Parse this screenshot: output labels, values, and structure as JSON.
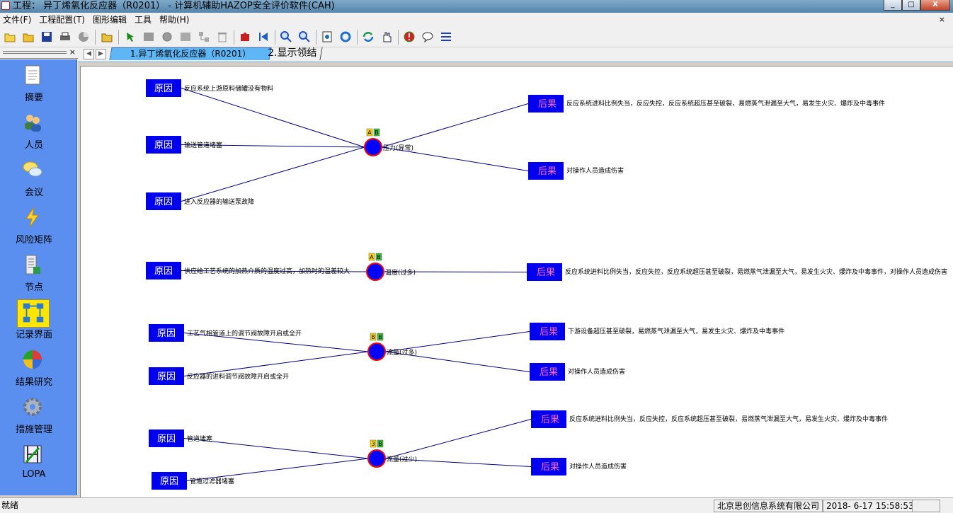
{
  "window": {
    "title": "工程： 异丁烯氧化反应器（R0201） - 计算机辅助HAZOP安全评价软件(CAH)",
    "min": "_",
    "max": "□",
    "close": "X"
  },
  "menu": [
    {
      "label": "文件(F)"
    },
    {
      "label": "工程配置(T)"
    },
    {
      "label": "图形编辑"
    },
    {
      "label": "工具"
    },
    {
      "label": "帮助(H)"
    }
  ],
  "menu_close": "×",
  "sidebar": {
    "close": "×",
    "items": [
      {
        "label": "摘要",
        "icon": "document-icon"
      },
      {
        "label": "人员",
        "icon": "people-icon"
      },
      {
        "label": "会议",
        "icon": "chat-bubbles-icon"
      },
      {
        "label": "风险矩阵",
        "icon": "lightning-icon"
      },
      {
        "label": "节点",
        "icon": "node-list-icon"
      },
      {
        "label": "记录界面",
        "icon": "flowchart-icon"
      },
      {
        "label": "结果研究",
        "icon": "pie-chart-icon"
      },
      {
        "label": "措施管理",
        "icon": "gear-icon"
      },
      {
        "label": "LOPA",
        "icon": "lopa-icon"
      }
    ]
  },
  "tabs": [
    {
      "label": "1.异丁烯氧化反应器（R0201）",
      "active": true
    },
    {
      "label": "2.显示领结",
      "active": false
    }
  ],
  "tab_nav": {
    "prev": "◀",
    "next": "▶"
  },
  "graph": {
    "cause_label": "原因",
    "consequence_label": "后果",
    "deviations": [
      {
        "id": "d1",
        "label": "压力(异常)",
        "badges": [
          "A",
          "B"
        ],
        "causes": [
          "反应系统上游原料储罐没有物料",
          "输送管道堵塞",
          "进入反应器的输送泵故障"
        ],
        "consequences": [
          "反应系统进料比例失当，反应失控，反应系统超压甚至破裂，易燃蒸气泄漏至大气，易发生火灾、爆炸及中毒事件",
          "对操作人员造成伤害"
        ]
      },
      {
        "id": "d2",
        "label": "温度(过多)",
        "badges": [
          "A",
          "B"
        ],
        "causes": [
          "供应给工艺系统的加热介质的温度过高，加热时的温差较大"
        ],
        "consequences": [
          "反应系统进料比例失当，反应失控，反应系统超压甚至破裂，易燃蒸气泄漏至大气，易发生火灾、爆炸及中毒事件，对操作人员造成伤害"
        ]
      },
      {
        "id": "d3",
        "label": "流量(过多)",
        "badges": [
          "B",
          "B"
        ],
        "causes": [
          "工艺气相管道上的调节阀故障开启或全开",
          "反应器的进料调节阀故障开启或全开"
        ],
        "consequences": [
          "下游设备超压甚至破裂，易燃蒸气泄漏至大气，易发生火灾、爆炸及中毒事件",
          "对操作人员造成伤害"
        ]
      },
      {
        "id": "d4",
        "label": "流量(过少)",
        "badges": [
          "3",
          "B"
        ],
        "causes": [
          "管道堵塞",
          "管道过滤器堵塞"
        ],
        "consequences": [
          "反应系统进料比例失当，反应失控，反应系统超压甚至破裂，易燃蒸气泄漏至大气，易发生火灾、爆炸及中毒事件",
          "对操作人员造成伤害"
        ]
      }
    ]
  },
  "status": {
    "text": "就绪",
    "company": "北京思创信息系统有限公司",
    "datetime": "2018- 6-17 15:58:53"
  },
  "colors": {
    "box_fill": "#0000ee",
    "line": "#000080",
    "node_fill": "#0000ff",
    "node_border": "#ff0000",
    "consequence_text": "#ff66cc",
    "sidebar_bg": "#5a8ff0",
    "tab_active": "#5fb6f7"
  }
}
